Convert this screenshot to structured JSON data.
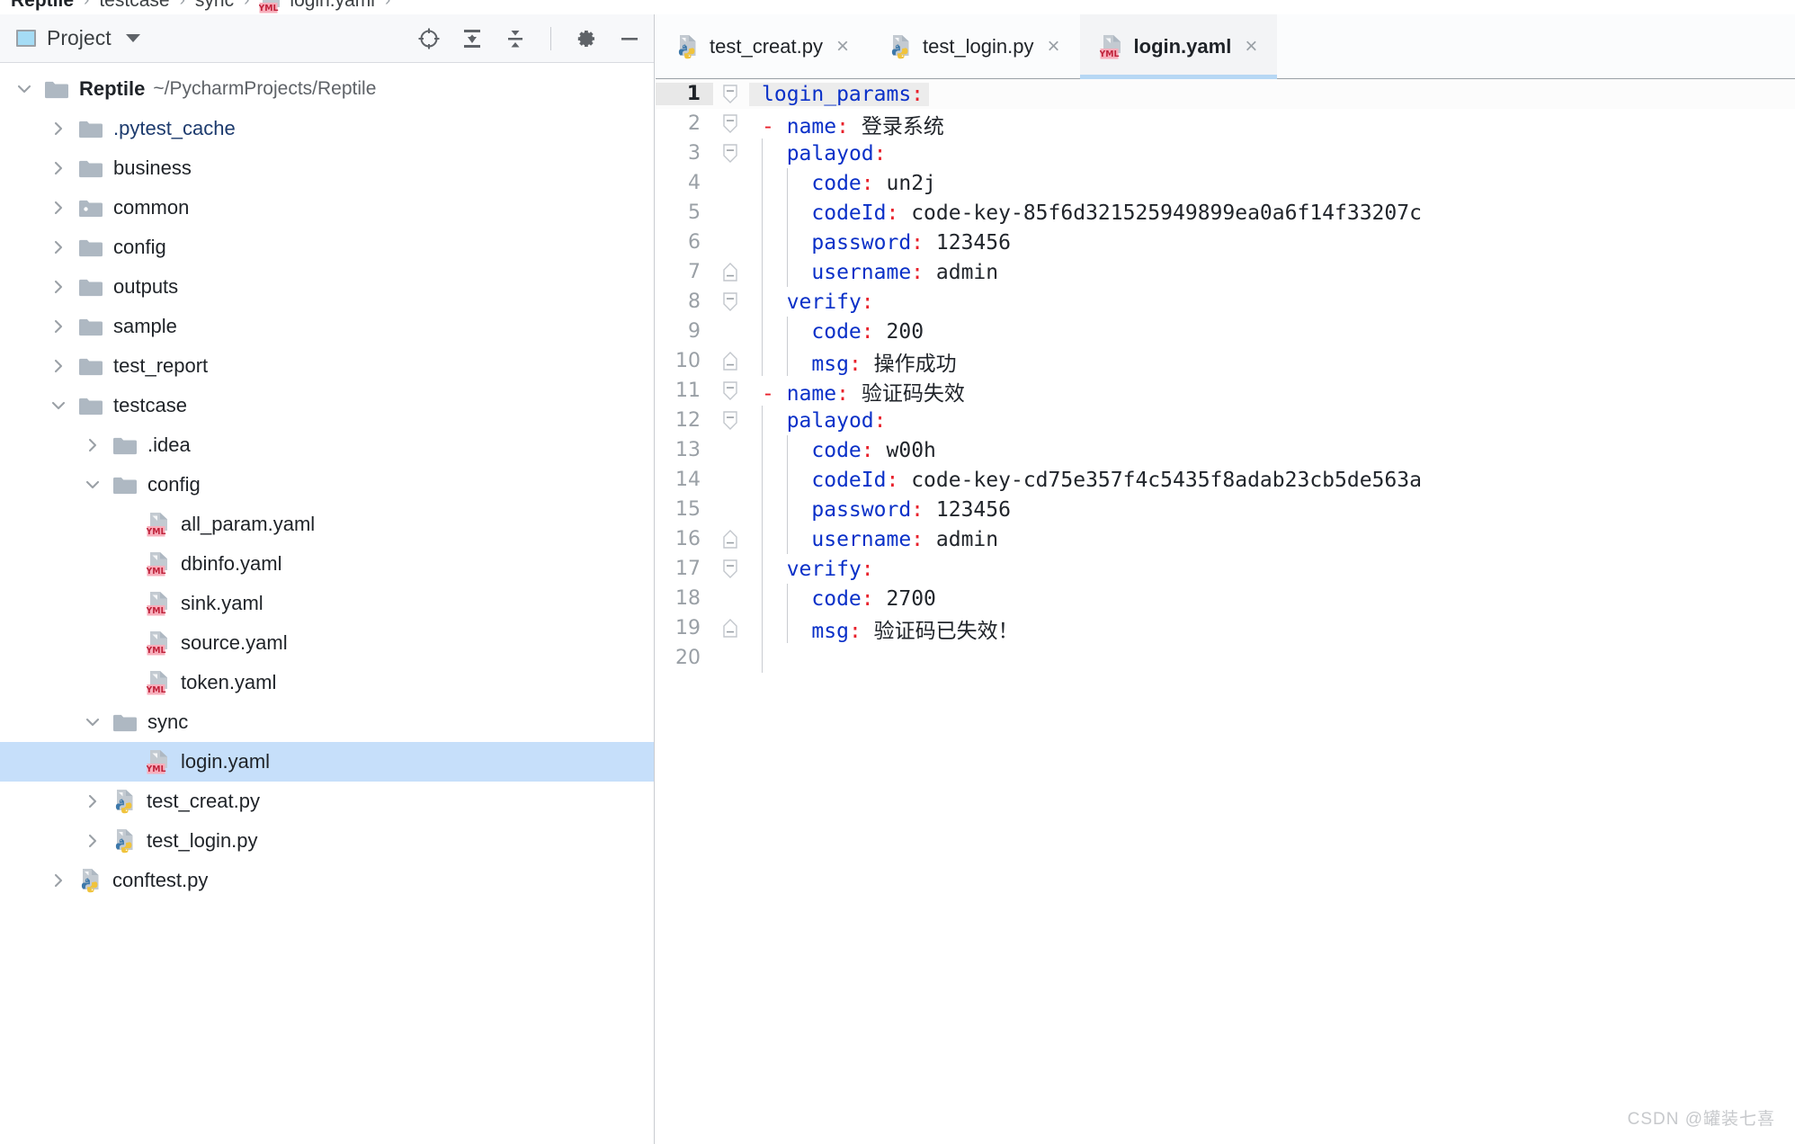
{
  "breadcrumb": {
    "items": [
      {
        "label": "Reptile",
        "bold": true,
        "icon": null
      },
      {
        "label": "testcase",
        "bold": false,
        "icon": null
      },
      {
        "label": "sync",
        "bold": false,
        "icon": null
      },
      {
        "label": "login.yaml",
        "bold": false,
        "icon": "yml-file-icon"
      }
    ],
    "separator": "›"
  },
  "project_panel": {
    "title": "Project",
    "dropdown_icon": "chevron-down-icon",
    "panel_icon": "project-window-icon",
    "tools": [
      {
        "name": "locate-in-tree-icon",
        "title": "Select Opened File"
      },
      {
        "name": "expand-all-icon",
        "title": "Expand All"
      },
      {
        "name": "collapse-all-icon",
        "title": "Collapse All"
      },
      {
        "name": "gear-icon",
        "title": "Settings"
      },
      {
        "name": "minimize-icon",
        "title": "Hide"
      }
    ],
    "tree": [
      {
        "label": "Reptile",
        "note": "~/PycharmProjects/Reptile",
        "indent": 0,
        "arrow": "down",
        "icon": "folder",
        "bold": true,
        "selected": false
      },
      {
        "label": ".pytest_cache",
        "note": "",
        "indent": 1,
        "arrow": "right",
        "icon": "folder",
        "excluded": true,
        "selected": false
      },
      {
        "label": "business",
        "note": "",
        "indent": 1,
        "arrow": "right",
        "icon": "folder",
        "selected": false
      },
      {
        "label": "common",
        "note": "",
        "indent": 1,
        "arrow": "right",
        "icon": "folder-source",
        "selected": false
      },
      {
        "label": "config",
        "note": "",
        "indent": 1,
        "arrow": "right",
        "icon": "folder",
        "selected": false
      },
      {
        "label": "outputs",
        "note": "",
        "indent": 1,
        "arrow": "right",
        "icon": "folder",
        "selected": false
      },
      {
        "label": "sample",
        "note": "",
        "indent": 1,
        "arrow": "right",
        "icon": "folder",
        "selected": false
      },
      {
        "label": "test_report",
        "note": "",
        "indent": 1,
        "arrow": "right",
        "icon": "folder",
        "selected": false
      },
      {
        "label": "testcase",
        "note": "",
        "indent": 1,
        "arrow": "down",
        "icon": "folder",
        "selected": false
      },
      {
        "label": ".idea",
        "note": "",
        "indent": 2,
        "arrow": "right",
        "icon": "folder",
        "selected": false
      },
      {
        "label": "config",
        "note": "",
        "indent": 2,
        "arrow": "down",
        "icon": "folder",
        "selected": false
      },
      {
        "label": "all_param.yaml",
        "note": "",
        "indent": 3,
        "arrow": "none",
        "icon": "yml-file",
        "selected": false
      },
      {
        "label": "dbinfo.yaml",
        "note": "",
        "indent": 3,
        "arrow": "none",
        "icon": "yml-file",
        "selected": false
      },
      {
        "label": "sink.yaml",
        "note": "",
        "indent": 3,
        "arrow": "none",
        "icon": "yml-file",
        "selected": false
      },
      {
        "label": "source.yaml",
        "note": "",
        "indent": 3,
        "arrow": "none",
        "icon": "yml-file",
        "selected": false
      },
      {
        "label": "token.yaml",
        "note": "",
        "indent": 3,
        "arrow": "none",
        "icon": "yml-file",
        "selected": false
      },
      {
        "label": "sync",
        "note": "",
        "indent": 2,
        "arrow": "down",
        "icon": "folder",
        "selected": false
      },
      {
        "label": "login.yaml",
        "note": "",
        "indent": 3,
        "arrow": "none",
        "icon": "yml-file",
        "selected": true
      },
      {
        "label": "test_creat.py",
        "note": "",
        "indent": 2,
        "arrow": "right",
        "icon": "py-file",
        "selected": false
      },
      {
        "label": "test_login.py",
        "note": "",
        "indent": 2,
        "arrow": "right",
        "icon": "py-file",
        "selected": false
      },
      {
        "label": "conftest.py",
        "note": "",
        "indent": 1,
        "arrow": "right",
        "icon": "py-file",
        "selected": false
      }
    ]
  },
  "editor": {
    "tabs": [
      {
        "label": "test_creat.py",
        "icon": "py-file-icon",
        "active": false,
        "close_icon": "×"
      },
      {
        "label": "test_login.py",
        "icon": "py-file-icon",
        "active": false,
        "close_icon": "×"
      },
      {
        "label": "login.yaml",
        "icon": "yml-file-icon",
        "active": true,
        "close_icon": "×"
      }
    ],
    "caret_line": 1,
    "lines": [
      {
        "n": 1,
        "fold": "open",
        "guide": 0,
        "indent": 0,
        "dash": false,
        "key": "login_params",
        "value": "",
        "caret": true
      },
      {
        "n": 2,
        "fold": "open",
        "guide": 0,
        "indent": 0,
        "dash": true,
        "key": "name",
        "value": "登录系统",
        "cjk": true
      },
      {
        "n": 3,
        "fold": "open",
        "guide": 1,
        "indent": 1,
        "dash": false,
        "key": "palayod",
        "value": ""
      },
      {
        "n": 4,
        "fold": "none",
        "guide": 2,
        "indent": 2,
        "dash": false,
        "key": "code",
        "value": "un2j"
      },
      {
        "n": 5,
        "fold": "none",
        "guide": 2,
        "indent": 2,
        "dash": false,
        "key": "codeId",
        "value": "code-key-85f6d321525949899ea0a6f14f33207c"
      },
      {
        "n": 6,
        "fold": "none",
        "guide": 2,
        "indent": 2,
        "dash": false,
        "key": "password",
        "value": "123456"
      },
      {
        "n": 7,
        "fold": "end",
        "guide": 2,
        "indent": 2,
        "dash": false,
        "key": "username",
        "value": "admin"
      },
      {
        "n": 8,
        "fold": "open",
        "guide": 1,
        "indent": 1,
        "dash": false,
        "key": "verify",
        "value": ""
      },
      {
        "n": 9,
        "fold": "none",
        "guide": 2,
        "indent": 2,
        "dash": false,
        "key": "code",
        "value": "200"
      },
      {
        "n": 10,
        "fold": "end",
        "guide": 2,
        "indent": 2,
        "dash": false,
        "key": "msg",
        "value": "操作成功",
        "cjk": true
      },
      {
        "n": 11,
        "fold": "open",
        "guide": 0,
        "indent": 0,
        "dash": true,
        "key": "name",
        "value": "验证码失效",
        "cjk": true
      },
      {
        "n": 12,
        "fold": "open",
        "guide": 1,
        "indent": 1,
        "dash": false,
        "key": "palayod",
        "value": ""
      },
      {
        "n": 13,
        "fold": "none",
        "guide": 2,
        "indent": 2,
        "dash": false,
        "key": "code",
        "value": "w00h"
      },
      {
        "n": 14,
        "fold": "none",
        "guide": 2,
        "indent": 2,
        "dash": false,
        "key": "codeId",
        "value": "code-key-cd75e357f4c5435f8adab23cb5de563a"
      },
      {
        "n": 15,
        "fold": "none",
        "guide": 2,
        "indent": 2,
        "dash": false,
        "key": "password",
        "value": "123456"
      },
      {
        "n": 16,
        "fold": "end",
        "guide": 2,
        "indent": 2,
        "dash": false,
        "key": "username",
        "value": "admin"
      },
      {
        "n": 17,
        "fold": "open",
        "guide": 1,
        "indent": 1,
        "dash": false,
        "key": "verify",
        "value": ""
      },
      {
        "n": 18,
        "fold": "none",
        "guide": 2,
        "indent": 2,
        "dash": false,
        "key": "code",
        "value": "2700"
      },
      {
        "n": 19,
        "fold": "end",
        "guide": 2,
        "indent": 2,
        "dash": false,
        "key": "msg",
        "value": "验证码已失效！",
        "cjk": true
      },
      {
        "n": 20,
        "fold": "none",
        "guide": 1,
        "indent": 0,
        "dash": false,
        "key": "",
        "value": ""
      }
    ]
  },
  "watermark": "CSDN @罐装七喜",
  "colors": {
    "selection": "#c6dffa",
    "yml_badge": "#f7aebb",
    "key": "#0a30c8",
    "colon": "#e8212b",
    "excluded_folder": "#1d3b6e",
    "tab_underline": "#b6d7f4"
  }
}
